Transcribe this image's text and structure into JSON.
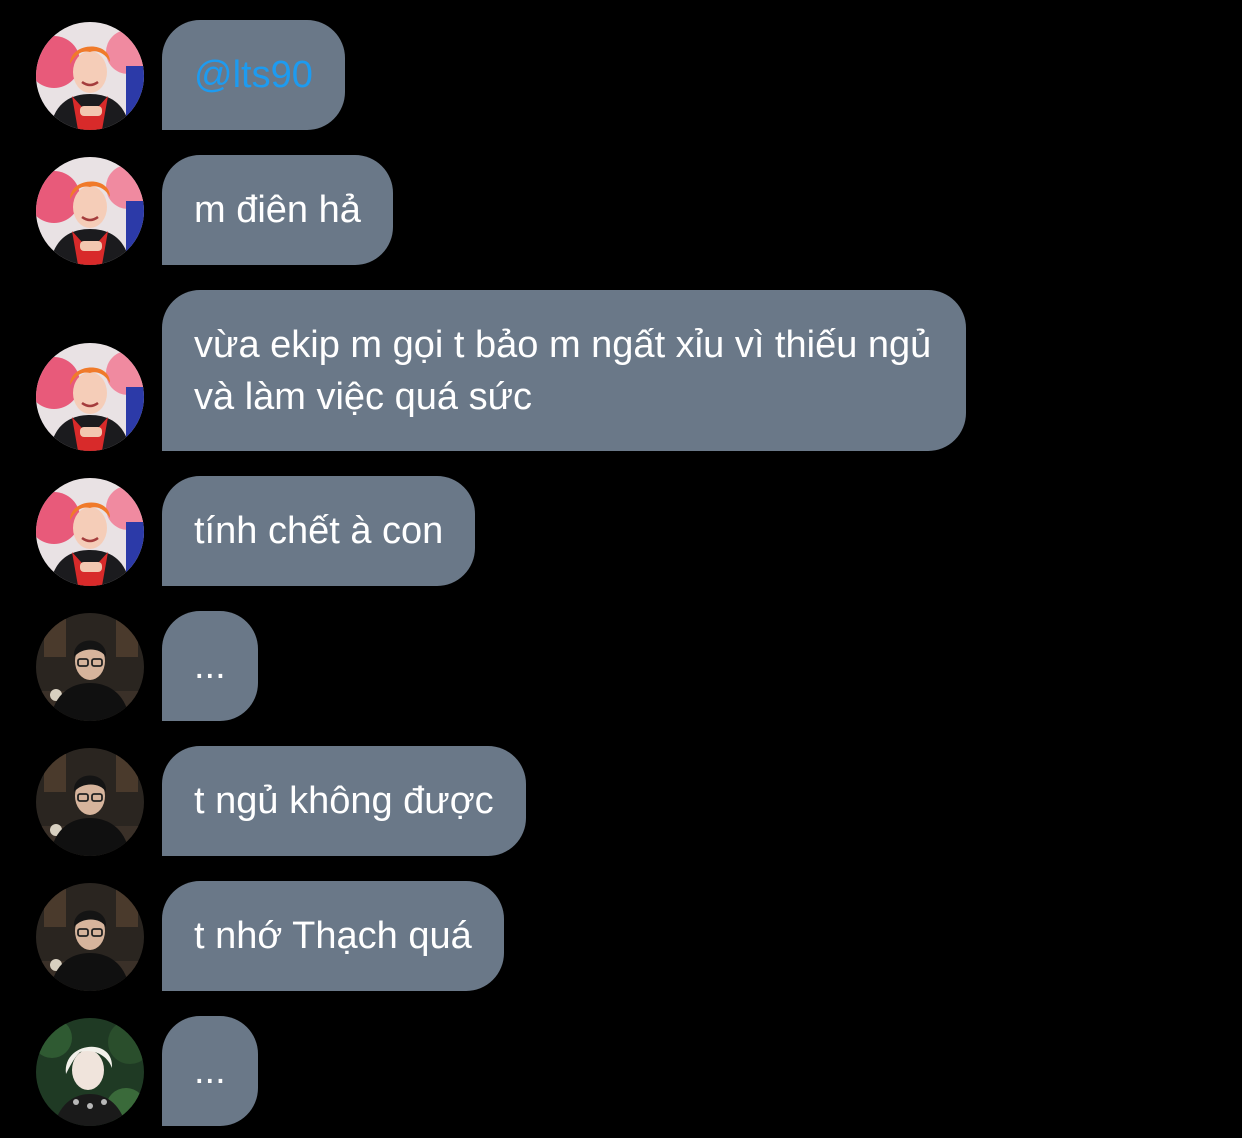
{
  "messages": [
    {
      "sender": "user_a",
      "text": "@lts90",
      "is_mention": true
    },
    {
      "sender": "user_a",
      "text": "m điên hả"
    },
    {
      "sender": "user_a",
      "text": "vừa ekip m gọi t bảo m ngất xỉu vì thiếu ngủ và làm việc quá sức"
    },
    {
      "sender": "user_a",
      "text": "tính chết à con"
    },
    {
      "sender": "user_b",
      "text": "..."
    },
    {
      "sender": "user_b",
      "text": "t ngủ không được"
    },
    {
      "sender": "user_b",
      "text": "t nhớ Thạch quá"
    },
    {
      "sender": "user_c",
      "text": "..."
    }
  ],
  "colors": {
    "background": "#000000",
    "bubble": "#6a7888",
    "bubble_text": "#ffffff",
    "mention": "#1d9bf0"
  },
  "icons": {
    "user_a": "avatar-orange-hair-person",
    "user_b": "avatar-dark-portrait-person",
    "user_c": "avatar-blonde-person-greenery"
  }
}
